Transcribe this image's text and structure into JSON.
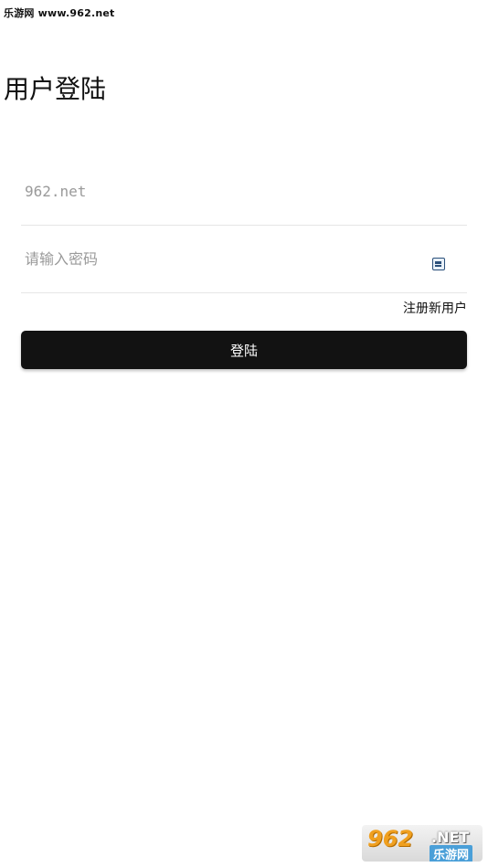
{
  "watermark": {
    "top_text": "乐游网 www.962.net"
  },
  "header": {
    "title": "用户登陆"
  },
  "form": {
    "username": {
      "value": "",
      "placeholder": "962.net"
    },
    "password": {
      "value": "",
      "placeholder": "请输入密码",
      "toggle_icon": "password-visibility-icon"
    },
    "register_label": "注册新用户",
    "login_label": "登陆"
  },
  "logo": {
    "main": "962",
    "net": ".NET",
    "sub": "乐游网"
  },
  "colors": {
    "button_bg": "#121212",
    "button_text": "#ffffff",
    "divider": "#e6e6e6",
    "placeholder": "#9a9a9a"
  }
}
